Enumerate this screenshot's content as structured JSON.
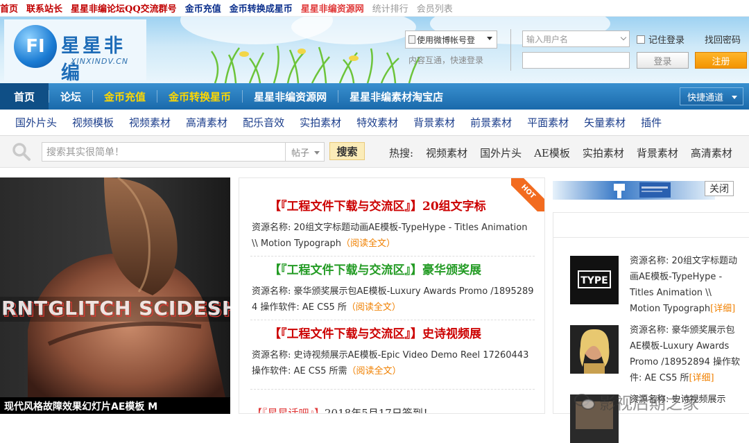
{
  "topbar": {
    "links": [
      {
        "label": "首页",
        "color": "#c00000"
      },
      {
        "label": "联系站长",
        "color": "#c00000"
      },
      {
        "label": "星星非编论坛QQ交流群号",
        "color": "#c00000"
      },
      {
        "label": "金币充值",
        "color": "#0b2f8c"
      },
      {
        "label": "金币转换成星币",
        "color": "#0b2f8c"
      },
      {
        "label": "星星非编资源网",
        "color": "#e03a3a"
      },
      {
        "label": "统计排行",
        "color": "#999999"
      },
      {
        "label": "会员列表",
        "color": "#999999"
      }
    ]
  },
  "header": {
    "logo_mark": "FI",
    "logo_cn": "星星非编",
    "logo_en": "XINXINDV.CN",
    "weibo_login": "使用微博帐号登",
    "weibo_note": "内容互通，快速登录",
    "username_placeholder": "输入用户名",
    "remember_label": "记住登录",
    "find_password": "找回密码",
    "login_button": "登录",
    "register_button": "注册"
  },
  "nav": {
    "items": [
      {
        "label": "首页",
        "active": true,
        "gold": false
      },
      {
        "label": "论坛",
        "active": false,
        "gold": false
      },
      {
        "label": "金币充值",
        "active": false,
        "gold": true
      },
      {
        "label": "金币转换星币",
        "active": false,
        "gold": true
      },
      {
        "label": "星星非编资源网",
        "active": false,
        "gold": false
      },
      {
        "label": "星星非编素材淘宝店",
        "active": false,
        "gold": false
      }
    ],
    "quick_access": "快捷通道"
  },
  "subnav": [
    "国外片头",
    "视频模板",
    "视频素材",
    "高清素材",
    "配乐音效",
    "实拍素材",
    "特效素材",
    "背景素材",
    "前景素材",
    "平面素材",
    "矢量素材",
    "插件"
  ],
  "search": {
    "placeholder": "搜索其实很简单！",
    "type": "帖子",
    "button": "搜索",
    "hot_label": "热搜:",
    "hot_terms": [
      "视频素材",
      "国外片头",
      "AE模板",
      "实拍素材",
      "背景素材",
      "高清素材"
    ]
  },
  "slideshow": {
    "overlay_text": "RNTGLITCH SCIDESHOW",
    "caption": "现代风格故障效果幻灯片AE模板 M"
  },
  "articles": [
    {
      "prefix": "【『工程文件下载与交流区』】",
      "title": "20组文字标",
      "prefix_color": "#cc0000",
      "line1_label": "资源名称:",
      "line1": "20组文字标题动画AE模板-TypeHype - Titles Animation",
      "line2": "\\\\ Motion Typograph",
      "read_more": "（阅读全文）"
    },
    {
      "prefix": "【『工程文件下载与交流区』】",
      "title": "豪华颁奖展",
      "prefix_color": "#239b24",
      "line1_label": "资源名称:",
      "line1": "豪华颁奖展示包AE模板-Luxury Awards Promo /1895289",
      "line2": "4 操作软件: AE CS5 所",
      "read_more": "（阅读全文）"
    },
    {
      "prefix": "【『工程文件下载与交流区』】",
      "title": "史诗视频展",
      "prefix_color": "#cc0000",
      "line1_label": "资源名称:",
      "line1": "史诗视频展示AE模板-Epic Video Demo Reel 17260443",
      "line2": "操作软件: AE CS5 所需",
      "read_more": "（阅读全文）"
    }
  ],
  "hot_badge": "HOT",
  "last_entry": {
    "prefix": "【『星星话吧』】",
    "text": "2018年5月17日签到！"
  },
  "right": {
    "close_button": "关闭",
    "items": [
      {
        "thumb_text": "TYPE",
        "text": "资源名称: 20组文字标题动画AE模板-TypeHype - Titles Animation \\\\ Motion Typograph",
        "detail": "[详细]"
      },
      {
        "thumb_text": "",
        "text": "资源名称: 豪华颁奖展示包AE模板-Luxury Awards Promo /18952894 操作软件: AE CS5 所",
        "detail": "[详细]"
      }
    ],
    "third_item_text": "资源名称: 史诗视频展示"
  },
  "watermark": "影视后期之家"
}
